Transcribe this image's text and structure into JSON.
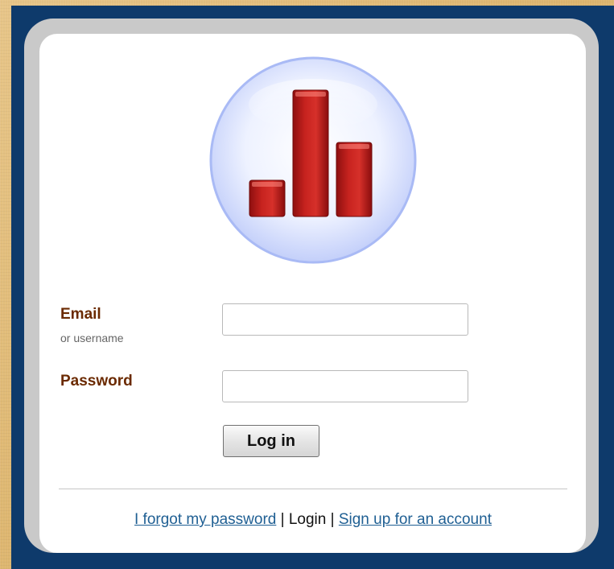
{
  "login_form": {
    "email_label": "Email",
    "email_sublabel": "or username",
    "email_value": "",
    "password_label": "Password",
    "password_value": "",
    "submit_label": "Log in"
  },
  "footer": {
    "forgot_password_link": "I forgot my password",
    "separator": "|",
    "current_page": "Login",
    "signup_link": "Sign up for an account"
  },
  "logo": {
    "icon": "bar-chart-logo-icon",
    "bar_color": "#c0201e",
    "circle_color": "#c6d4ff"
  },
  "colors": {
    "background": "#e2be7c",
    "frame": "#0e3a6b",
    "panel_border": "#c9c9c9",
    "label_color": "#6b2a00",
    "link_color": "#1f5f93"
  }
}
